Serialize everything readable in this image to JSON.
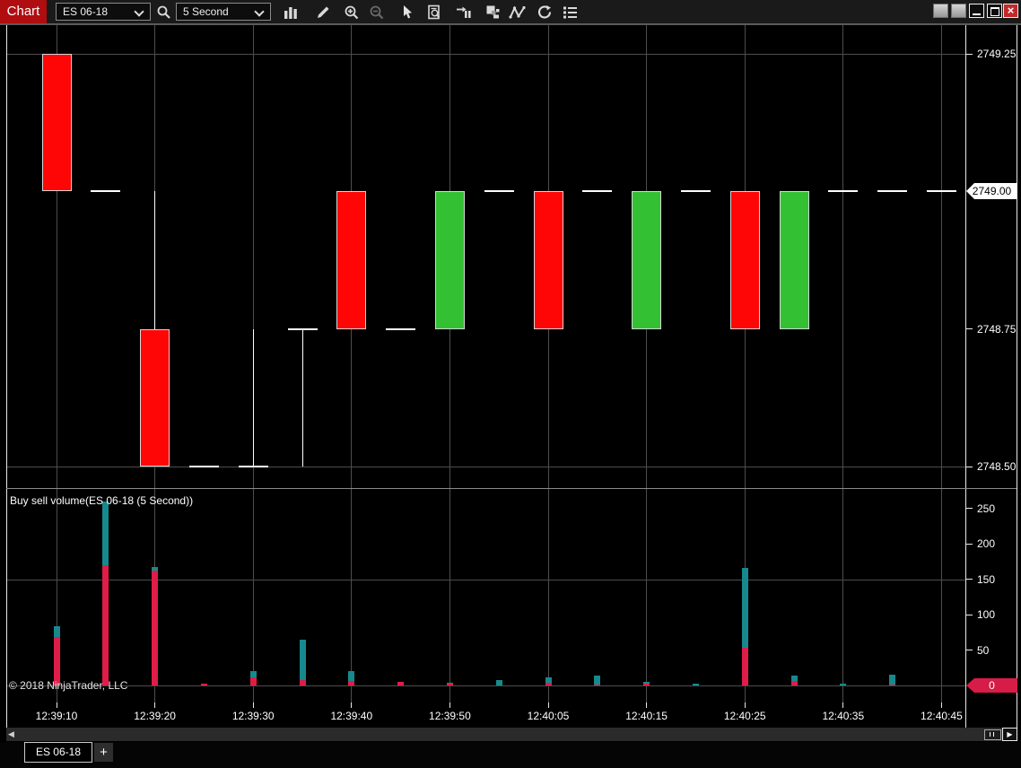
{
  "toolbar": {
    "title": "Chart",
    "instrument": {
      "value": "ES 06-18"
    },
    "interval": {
      "value": "5 Second"
    },
    "icons": [
      "search-icon",
      "chart-bars-icon",
      "pencil-icon",
      "zoom-in-icon",
      "zoom-out-icon",
      "cursor-icon",
      "data-box-icon",
      "bar-period-icon",
      "layers-icon",
      "zigzag-icon",
      "reload-icon",
      "properties-icon"
    ]
  },
  "window": {
    "controls": [
      "blank-button",
      "blank-button",
      "minimize-button",
      "restore-button",
      "close-button"
    ]
  },
  "price_panel": {
    "axis_labels": [
      2749.25,
      2748.75,
      2748.5
    ],
    "grid_prices": [
      2749.25,
      2748.5
    ],
    "last_price_marker": "2749.00"
  },
  "volume_panel": {
    "title": "Buy sell volume(ES 06-18 (5 Second))",
    "axis_labels": [
      250,
      200,
      150,
      100,
      50
    ],
    "grid_values": [
      150,
      0
    ],
    "zero_marker": "0",
    "copyright": "© 2018 NinjaTrader, LLC"
  },
  "time_axis": {
    "labels": [
      "12:39:10",
      "12:39:20",
      "12:39:30",
      "12:39:40",
      "12:39:50",
      "12:40:05",
      "12:40:15",
      "12:40:25",
      "12:40:35",
      "12:40:45"
    ]
  },
  "tabs": {
    "active": "ES 06-18",
    "add_button": "+"
  },
  "colors": {
    "candle_up": "#33c133",
    "candle_down": "#fe0606",
    "candle_border": "#d6d6d6",
    "wick": "#ffffff",
    "doji_dash": "#ffffff",
    "buy_volume": "#17898e",
    "sell_volume": "#e01c48",
    "zero_marker_bg": "#d81c48",
    "last_price_bg": "#ffffff",
    "grid": "#4d4d4d",
    "axis_line": "#e8e8e8",
    "title_accent": "#b00d10"
  },
  "chart_data": {
    "type": "candlestick_with_volume",
    "instrument": "ES 06-18",
    "interval": "5 Second",
    "price_axis_ticks": [
      2749.25,
      2749.0,
      2748.75,
      2748.5
    ],
    "volume_axis_ticks": [
      250,
      200,
      150,
      100,
      50,
      0
    ],
    "last_price": 2749.0,
    "time_tick_labels": [
      "12:39:10",
      "12:39:20",
      "12:39:30",
      "12:39:40",
      "12:39:50",
      "12:40:05",
      "12:40:15",
      "12:40:25",
      "12:40:35",
      "12:40:45"
    ],
    "bars": [
      {
        "type": "candle",
        "dir": "down",
        "open": 2749.25,
        "high": 2749.25,
        "low": 2749.0,
        "close": 2749.0
      },
      {
        "type": "doji",
        "price": 2749.0,
        "high": 2749.0,
        "low": 2749.0
      },
      {
        "type": "candle",
        "dir": "down",
        "open": 2748.75,
        "high": 2749.0,
        "low": 2748.5,
        "close": 2748.5
      },
      {
        "type": "doji",
        "price": 2748.5,
        "high": 2748.5,
        "low": 2748.5
      },
      {
        "type": "doji",
        "price": 2748.5,
        "high": 2748.75,
        "low": 2748.5
      },
      {
        "type": "doji",
        "price": 2748.75,
        "high": 2748.75,
        "low": 2748.5
      },
      {
        "type": "candle",
        "dir": "down",
        "open": 2749.0,
        "high": 2749.0,
        "low": 2748.75,
        "close": 2748.75
      },
      {
        "type": "doji",
        "price": 2748.75,
        "high": 2748.75,
        "low": 2748.75
      },
      {
        "type": "candle",
        "dir": "up",
        "open": 2748.75,
        "high": 2749.0,
        "low": 2748.75,
        "close": 2749.0
      },
      {
        "type": "doji",
        "price": 2749.0,
        "high": 2749.0,
        "low": 2749.0
      },
      {
        "type": "candle",
        "dir": "down",
        "open": 2749.0,
        "high": 2749.0,
        "low": 2748.75,
        "close": 2748.75
      },
      {
        "type": "doji",
        "price": 2749.0,
        "high": 2749.0,
        "low": 2749.0
      },
      {
        "type": "candle",
        "dir": "up",
        "open": 2748.75,
        "high": 2749.0,
        "low": 2748.75,
        "close": 2749.0
      },
      {
        "type": "doji",
        "price": 2749.0,
        "high": 2749.0,
        "low": 2749.0
      },
      {
        "type": "candle",
        "dir": "down",
        "open": 2749.0,
        "high": 2749.0,
        "low": 2748.75,
        "close": 2748.75
      },
      {
        "type": "candle",
        "dir": "up",
        "open": 2748.75,
        "high": 2749.0,
        "low": 2748.75,
        "close": 2749.0
      },
      {
        "type": "doji",
        "price": 2749.0,
        "high": 2749.0,
        "low": 2749.0
      },
      {
        "type": "doji",
        "price": 2749.0,
        "high": 2749.0,
        "low": 2749.0
      },
      {
        "type": "doji",
        "price": 2749.0,
        "high": 2749.0,
        "low": 2749.0
      }
    ],
    "volume": [
      {
        "sell": 68,
        "buy": 16
      },
      {
        "sell": 170,
        "buy": 90
      },
      {
        "sell": 162,
        "buy": 5
      },
      {
        "sell": 2,
        "buy": 0
      },
      {
        "sell": 11,
        "buy": 9
      },
      {
        "sell": 8,
        "buy": 57
      },
      {
        "sell": 6,
        "buy": 14
      },
      {
        "sell": 5,
        "buy": 0
      },
      {
        "sell": 3,
        "buy": 1
      },
      {
        "sell": 0,
        "buy": 7
      },
      {
        "sell": 4,
        "buy": 8
      },
      {
        "sell": 1,
        "buy": 13
      },
      {
        "sell": 2,
        "buy": 3
      },
      {
        "sell": 0,
        "buy": 3
      },
      {
        "sell": 53,
        "buy": 113
      },
      {
        "sell": 6,
        "buy": 8
      },
      {
        "sell": 0,
        "buy": 2
      },
      {
        "sell": 1,
        "buy": 14
      },
      {
        "sell": 0,
        "buy": 0
      }
    ]
  }
}
